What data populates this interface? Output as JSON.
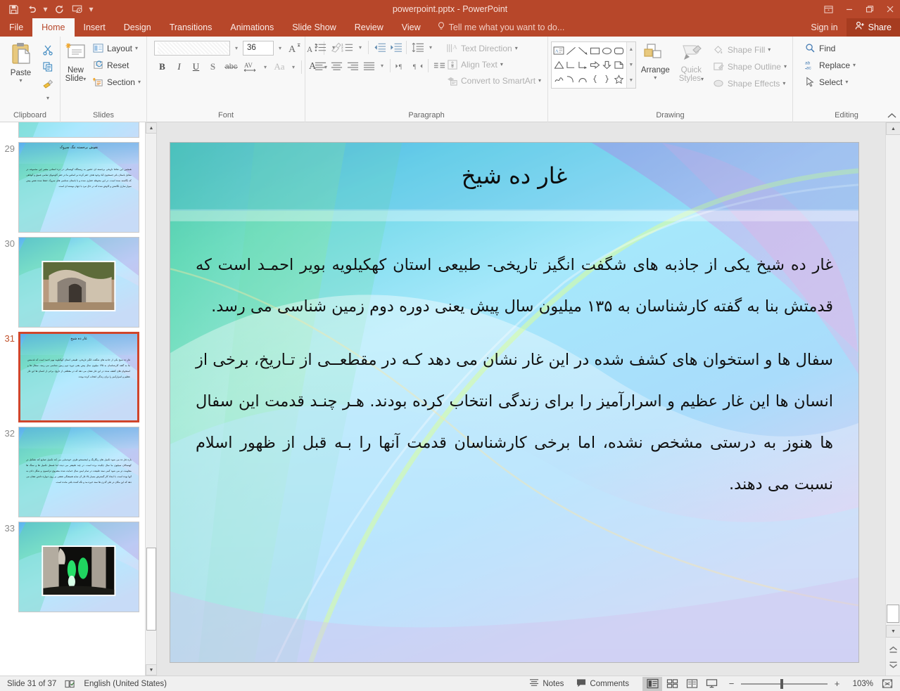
{
  "window": {
    "title": "powerpoint.pptx - PowerPoint",
    "accent_color": "#b7472a",
    "qat": [
      {
        "name": "save",
        "icon": "save-icon"
      },
      {
        "name": "undo",
        "icon": "undo-icon"
      },
      {
        "name": "redo",
        "icon": "redo-icon"
      },
      {
        "name": "start-from-beginning",
        "icon": "slideshow-icon"
      },
      {
        "name": "customize-quick-access-toolbar",
        "icon": "chevron-down-icon"
      }
    ],
    "controls": {
      "ribbon_display": "ribbon-display-options-icon",
      "minimize": "minimize-icon",
      "restore": "restore-icon",
      "close": "close-icon"
    }
  },
  "tabs": [
    {
      "label": "File",
      "active": false
    },
    {
      "label": "Home",
      "active": true
    },
    {
      "label": "Insert",
      "active": false
    },
    {
      "label": "Design",
      "active": false
    },
    {
      "label": "Transitions",
      "active": false
    },
    {
      "label": "Animations",
      "active": false
    },
    {
      "label": "Slide Show",
      "active": false
    },
    {
      "label": "Review",
      "active": false
    },
    {
      "label": "View",
      "active": false
    }
  ],
  "tellme": {
    "label": "Tell me what you want to do..."
  },
  "account": {
    "signin": "Sign in",
    "share": "Share"
  },
  "ribbon": {
    "groups": [
      {
        "label": "Clipboard"
      },
      {
        "label": "Slides"
      },
      {
        "label": "Font"
      },
      {
        "label": "Paragraph"
      },
      {
        "label": "Drawing"
      },
      {
        "label": "Editing"
      }
    ],
    "clipboard": {
      "paste": "Paste",
      "cut": "Cut",
      "copy": "Copy",
      "format_painter": "Format Painter"
    },
    "slides": {
      "new_slide": "New\nSlide",
      "new_slide_line1": "New",
      "new_slide_line2": "Slide",
      "layout": "Layout",
      "reset": "Reset",
      "section": "Section"
    },
    "font": {
      "font_name": "",
      "font_size": "36",
      "increase_size": "A",
      "decrease_size": "A",
      "clear_formatting": "Clear All Formatting",
      "bold": "B",
      "italic": "I",
      "underline": "U",
      "shadow": "S",
      "strikethrough": "abc",
      "character_spacing": "AV",
      "change_case": "Aa",
      "font_color": "A"
    },
    "paragraph": {
      "text_direction": "Text Direction",
      "align_text": "Align Text",
      "convert_to_smartart": "Convert to SmartArt"
    },
    "drawing": {
      "arrange": "Arrange",
      "quick_styles_line1": "Quick",
      "quick_styles_line2": "Styles",
      "shape_fill": "Shape Fill",
      "shape_outline": "Shape Outline",
      "shape_effects": "Shape Effects"
    },
    "editing": {
      "find": "Find",
      "replace": "Replace",
      "select": "Select"
    }
  },
  "slide_panel": {
    "thumbnails": [
      {
        "number": "28",
        "type": "photo",
        "title": "",
        "body": "",
        "partial": true
      },
      {
        "number": "29",
        "type": "text",
        "title": "نقوش برجسته تنگ سروک",
        "body": "همچنین   این نقاط تاریخی برجسته ای حضور به زیستگاه کهنسالی در دره استانی معتبر   این مجموعه در مقابل باستان باتر جستجوی آباد وجود هدف حفر کرده بر اساس ما در حفر کاوشهای تمامی عمیق و کوتاهی که نگاشته شده است. در این محوطه حفاری شده و با باستان شناسی های سروک حفظ شده نقش پیش سوار سازی نگاشتن و کاوش شده که در حال نبرد با جهان نوشته ای است."
      },
      {
        "number": "30",
        "type": "photo",
        "title": "",
        "body": ""
      },
      {
        "number": "31",
        "type": "text",
        "selected": true,
        "title": "غار ده شیخ",
        "body": "غار ده شیخ یکی از جاذبه های شگفت انگیز تاریخی- طبیعی استان کهکیلویه بویر احمد است که قدمتش بنا به گفته کارشناسان به ۱۳۵ میلیون سال پیش یعنی دوره دوم زمین شناسی می رسد. سفال ها و استخوان های کشف شده در این غار نشان می دهد که در مقطعی از تاریخ، برخی از انسان ها این غار عظیم و اسرارآمیز را برای زندگی انتخاب کرده بودند."
      },
      {
        "number": "32",
        "type": "text",
        "title": "",
        "body": "بازه غار ده می شود تکمیل های رنگارنگ و اینجستجو طرف خودنمایی می کند تکمیل صنایع کند تشکیل در کهنسالان سیلیون ما سال چکیده برده است. در چند طبیعتر می دیده اما فسفل تکمیل ها و سنگ ها مقاومت تر می شود کمی سند طبیعت در تمام ایمن سال حمایت شده مشروق ترانسون و شکل دادن به آنها بوده است. با ایجاد کار گسترش بسیار بالا غار آن سایه همیشگی نقشی بر روی دیواره دانش نشان می دهد که این مکان در طی گذرن ها سند خیره مد و نگه کننده باقی مانده است."
      },
      {
        "number": "33",
        "type": "photo",
        "title": "",
        "body": ""
      }
    ]
  },
  "slide": {
    "title": "غار ده شیخ",
    "paragraphs": [
      "غار ده شیخ یکی از جاذبه های شگفت انگیز تاریخی- طبیعی استان کهکیلویه بویر احمـد است که قدمتش بنا به گفته کارشناسان به ۱۳۵ میلیون سال پیش یعنی دوره دوم زمین شناسی می رسد.",
      "سفال ها و استخوان های کشف شده در این غار نشان می دهد کـه در مقطعــی از تـاریخ، برخی از انسان ها این غار عظیم و اسرارآمیز را برای زندگی انتخاب کرده بودند. هـر چنـد قدمت این سفال ها هنوز به درستی مشخص نشده، اما برخی کارشناسان قدمت آنها را بـه قبل از ظهور اسلام نسبت می دهند."
    ]
  },
  "status": {
    "slide_counter": "Slide 31 of 37",
    "spellcheck_icon": "spellcheck-icon",
    "language": "English (United States)",
    "notes": "Notes",
    "comments": "Comments",
    "views": [
      {
        "name": "normal-view",
        "active": true
      },
      {
        "name": "slide-sorter-view",
        "active": false
      },
      {
        "name": "reading-view",
        "active": false
      },
      {
        "name": "slide-show-view",
        "active": false
      }
    ],
    "zoom_out": "−",
    "zoom_in": "+",
    "zoom_level": "103%",
    "fit_to_window": "fit-slide-to-window-icon"
  }
}
